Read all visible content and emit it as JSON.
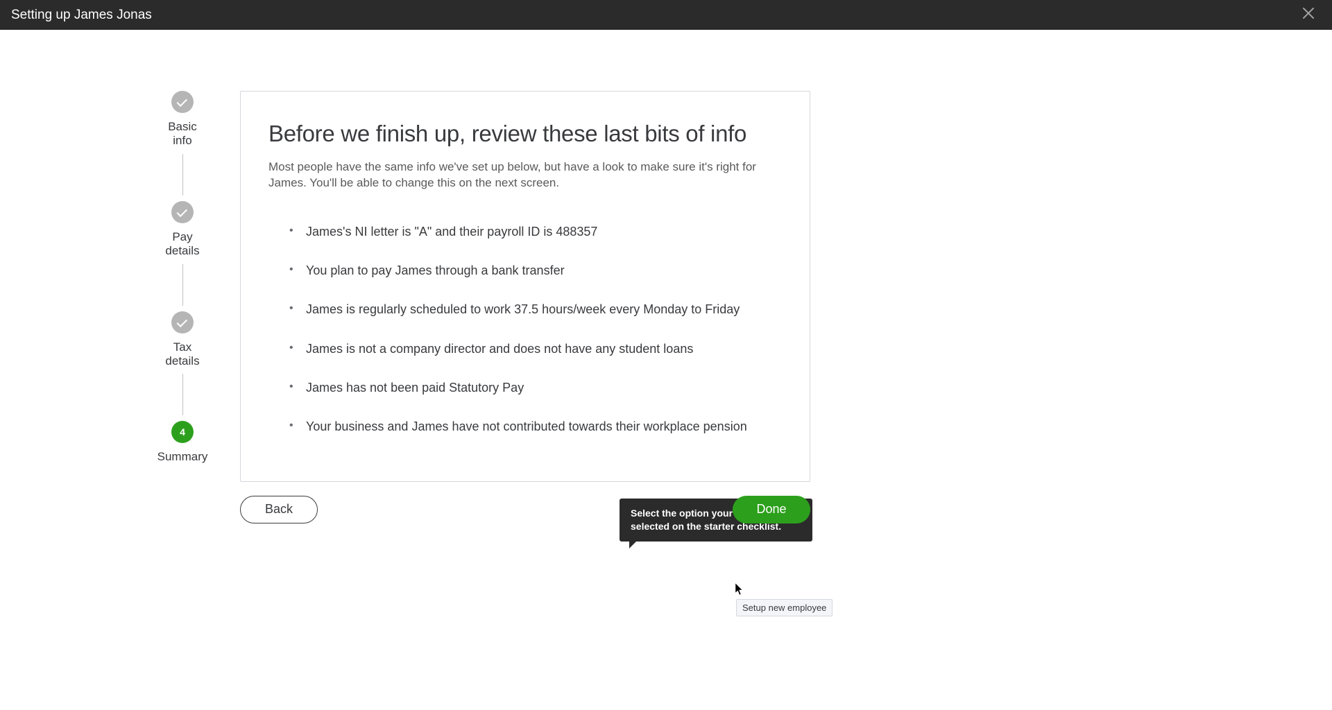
{
  "header": {
    "title": "Setting up James Jonas"
  },
  "stepper": {
    "steps": [
      {
        "label": "Basic\ninfo",
        "state": "done"
      },
      {
        "label": "Pay\ndetails",
        "state": "done"
      },
      {
        "label": "Tax\ndetails",
        "state": "done"
      },
      {
        "label": "Summary",
        "state": "active",
        "number": "4"
      }
    ]
  },
  "panel": {
    "heading": "Before we finish up, review these last bits of info",
    "subtext": "Most people have the same info we've set up below, but have a look to make sure it's right for James. You'll be able to change this on the next screen.",
    "items": [
      "James's NI letter is \"A\" and their payroll ID is 488357",
      "You plan to pay James through a bank transfer",
      "James is regularly scheduled to work 37.5 hours/week every Monday to Friday",
      "James is not a company director and does not have any student loans",
      "James has not been paid Statutory Pay",
      "Your business and James have not contributed towards their workplace pension"
    ]
  },
  "actions": {
    "back": "Back",
    "done": "Done"
  },
  "tooltip": {
    "text": "Select the option your employee selected on the starter checklist."
  },
  "hover_label": "Setup new employee"
}
